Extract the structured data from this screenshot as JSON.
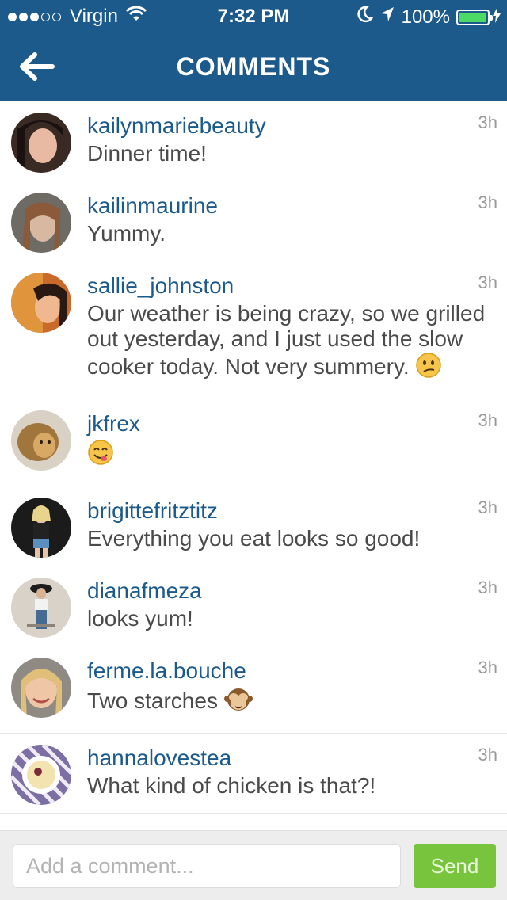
{
  "status_bar": {
    "carrier": "Virgin",
    "time": "7:32 PM",
    "battery": "100%",
    "battery_level": 1.0,
    "signal_bars_filled": 3,
    "signal_bars_total": 5
  },
  "header": {
    "title": "COMMENTS",
    "background_color": "#1b5a8b"
  },
  "comments": [
    {
      "username": "kailynmariebeauty",
      "text": "Dinner time!",
      "time": "3h"
    },
    {
      "username": "kailinmaurine",
      "text": "Yummy.",
      "time": "3h"
    },
    {
      "username": "sallie_johnston",
      "text": "Our weather is being crazy, so we grilled out yesterday, and I just used the slow cooker today. Not very summery. ",
      "emoji": "confused-face",
      "time": "3h"
    },
    {
      "username": "jkfrex",
      "text": "",
      "emoji": "smiling-face-tongue",
      "time": "3h"
    },
    {
      "username": "brigittefritztitz",
      "text": "Everything you eat looks so good!",
      "time": "3h"
    },
    {
      "username": "dianafmeza",
      "text": "looks yum!",
      "time": "3h"
    },
    {
      "username": "ferme.la.bouche",
      "text": "Two starches ",
      "emoji": "see-no-evil-monkey",
      "time": "3h"
    },
    {
      "username": "hannalovestea",
      "text": "What kind of chicken is that?!",
      "time": "3h"
    }
  ],
  "composer": {
    "placeholder": "Add a comment...",
    "send_label": "Send",
    "send_color": "#78c43d"
  }
}
